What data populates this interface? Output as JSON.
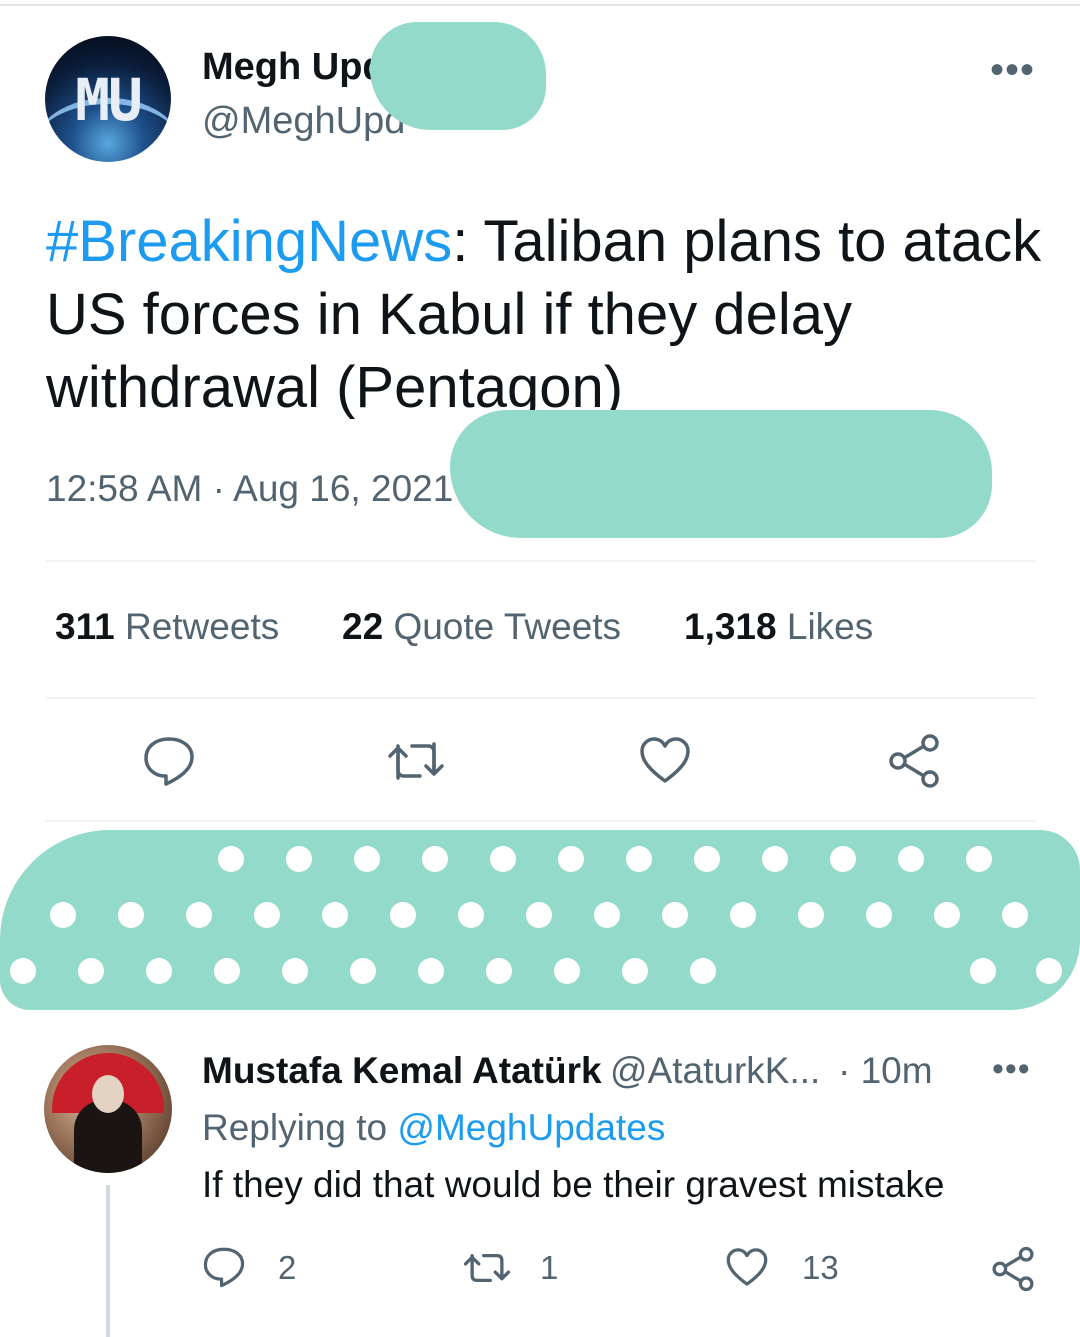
{
  "tweet": {
    "author_name": "Megh Upd",
    "author_handle": "@MeghUpd",
    "avatar_text": "MU",
    "hashtag": "#BreakingNews",
    "text": ": Taliban plans to atack US forces in Kabul if they delay withdrawal (Pentagon)",
    "timestamp": "12:58 AM · Aug 16, 2021",
    "more_label": "•••"
  },
  "stats": {
    "retweets_count": "311",
    "retweets_label": "Retweets",
    "quotes_count": "22",
    "quotes_label": "Quote Tweets",
    "likes_count": "1,318",
    "likes_label": "Likes"
  },
  "icons": {
    "reply": "reply-icon",
    "retweet": "retweet-icon",
    "like": "heart-icon",
    "share": "share-icon",
    "more": "more-icon"
  },
  "reply": {
    "author_name": "Mustafa Kemal Atatürk",
    "author_handle": "@AtaturkK...",
    "time": "· 10m",
    "replying_prefix": "Replying to",
    "replying_to": "@MeghUpdates",
    "text": "If they did that would be their gravest mistake",
    "reply_count": "2",
    "retweet_count": "1",
    "like_count": "13",
    "more_label": "•••"
  },
  "colors": {
    "accent": "#1d9bf0",
    "secondary_text": "#536471",
    "redaction": "#93dacb"
  }
}
